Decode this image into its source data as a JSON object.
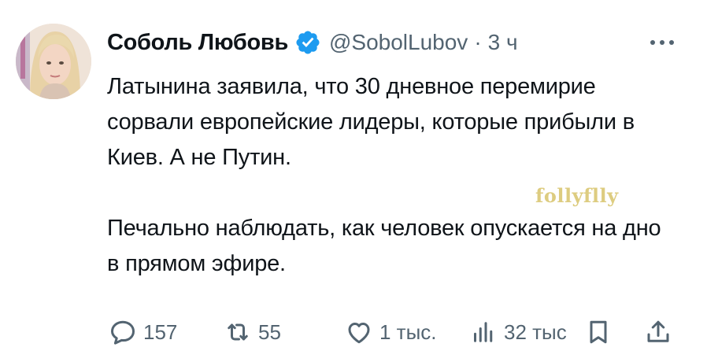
{
  "author": {
    "name": "Соболь Любовь",
    "handle": "@SobolLubov",
    "separator": "·",
    "time": "3 ч",
    "avatar": "avatar-photo",
    "verified_icon": "verified-badge-icon",
    "verified_color": "#1d9bf0"
  },
  "tweet": {
    "paragraph_1": "Латынина заявила, что 30 дневное перемирие сорвали европейские лидеры, которые прибыли в Киев. А не Путин.",
    "paragraph_2": "Печально наблюдать, как человек опускается на дно в прямом эфире."
  },
  "watermark": "follyflly",
  "actions": {
    "reply": {
      "icon": "reply-icon",
      "count": "157"
    },
    "retweet": {
      "icon": "retweet-icon",
      "count": "55"
    },
    "like": {
      "icon": "heart-icon",
      "count": "1 тыс."
    },
    "views": {
      "icon": "views-chart-icon",
      "count": "32 тыс"
    },
    "bookmark": {
      "icon": "bookmark-icon"
    },
    "share": {
      "icon": "share-icon"
    }
  },
  "colors": {
    "text": "#0f1419",
    "secondary": "#536471",
    "accent": "#1d9bf0"
  }
}
